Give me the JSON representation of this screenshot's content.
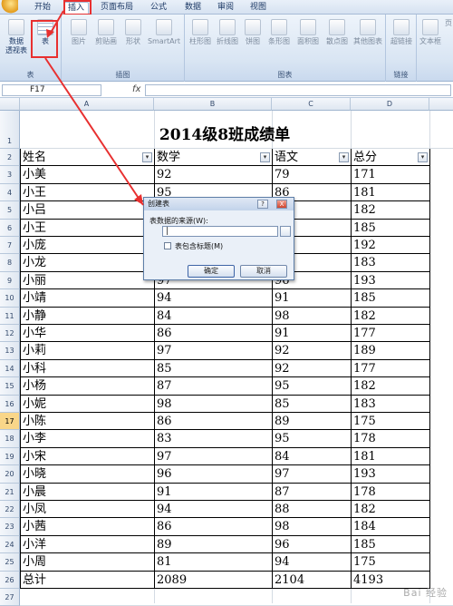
{
  "ribbon_tabs": [
    "开始",
    "插入",
    "页面布局",
    "公式",
    "数据",
    "审阅",
    "视图"
  ],
  "ribbon": {
    "groups": [
      {
        "label": "表",
        "buttons": [
          "数据\n透视表",
          "表"
        ]
      },
      {
        "label": "插图",
        "buttons": [
          "图片",
          "剪贴画",
          "形状",
          "SmartArt"
        ]
      },
      {
        "label": "图表",
        "buttons": [
          "柱形图",
          "折线图",
          "饼图",
          "条形图",
          "面积图",
          "散点图",
          "其他图表"
        ]
      },
      {
        "label": "链接",
        "buttons": [
          "超链接"
        ]
      },
      {
        "label": "",
        "buttons": [
          "文本框",
          "页"
        ]
      }
    ]
  },
  "formula_bar": {
    "name_box": "F17",
    "fx": "fx"
  },
  "columns": [
    "A",
    "B",
    "C",
    "D"
  ],
  "sheet": {
    "title": "2014级8班成绩单",
    "headers": [
      "姓名",
      "数学",
      "语文",
      "总分"
    ],
    "rows": [
      [
        "小美",
        "92",
        "79",
        "171"
      ],
      [
        "小王",
        "95",
        "86",
        "181"
      ],
      [
        "小吕",
        "",
        "",
        "182"
      ],
      [
        "小王",
        "",
        "",
        "185"
      ],
      [
        "小庞",
        "",
        "",
        "192"
      ],
      [
        "小龙",
        "",
        "",
        "183"
      ],
      [
        "小丽",
        "97",
        "96",
        "193"
      ],
      [
        "小靖",
        "94",
        "91",
        "185"
      ],
      [
        "小静",
        "84",
        "98",
        "182"
      ],
      [
        "小华",
        "86",
        "91",
        "177"
      ],
      [
        "小莉",
        "97",
        "92",
        "189"
      ],
      [
        "小科",
        "85",
        "92",
        "177"
      ],
      [
        "小杨",
        "87",
        "95",
        "182"
      ],
      [
        "小妮",
        "98",
        "85",
        "183"
      ],
      [
        "小陈",
        "86",
        "89",
        "175"
      ],
      [
        "小李",
        "83",
        "95",
        "178"
      ],
      [
        "小宋",
        "97",
        "84",
        "181"
      ],
      [
        "小晓",
        "96",
        "97",
        "193"
      ],
      [
        "小晨",
        "91",
        "87",
        "178"
      ],
      [
        "小凤",
        "94",
        "88",
        "182"
      ],
      [
        "小茜",
        "86",
        "98",
        "184"
      ],
      [
        "小洋",
        "89",
        "96",
        "185"
      ],
      [
        "小周",
        "81",
        "94",
        "175"
      ]
    ],
    "total": [
      "总计",
      "2089",
      "2104",
      "4193"
    ],
    "row_numbers": [
      "1",
      "2",
      "3",
      "4",
      "5",
      "6",
      "7",
      "8",
      "9",
      "10",
      "11",
      "12",
      "13",
      "14",
      "15",
      "16",
      "17",
      "18",
      "19",
      "20",
      "21",
      "22",
      "23",
      "24",
      "25",
      "26",
      "27"
    ],
    "selected_row": "17"
  },
  "dialog": {
    "title": "创建表",
    "help": "?",
    "close": "X",
    "source_label": "表数据的来源(W):",
    "source_value": "|",
    "has_headers_label": "表包含标题(M)",
    "ok": "确定",
    "cancel": "取消"
  },
  "watermark": "Bai 经验",
  "colors": {
    "annotation_red": "#e83030",
    "selected_row": "#f9d689"
  }
}
